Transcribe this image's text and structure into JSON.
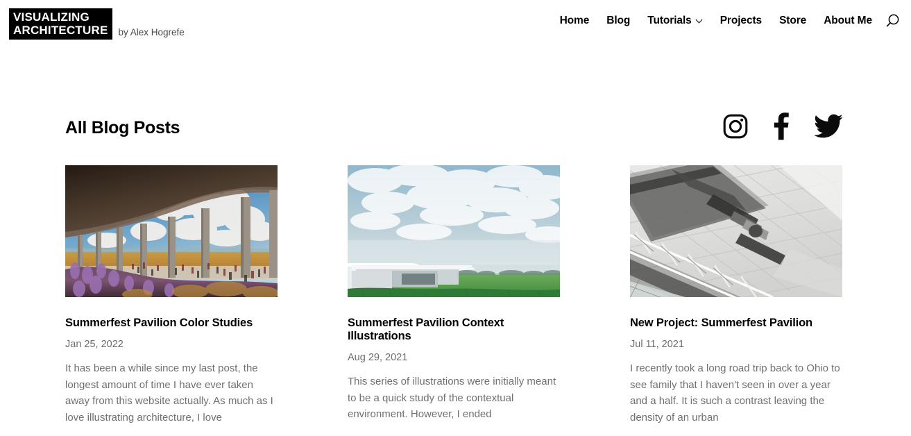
{
  "header": {
    "logo": {
      "line1": "VISUALIZING",
      "line2": "ARCHITECTURE",
      "byline": "by Alex Hogrefe"
    },
    "nav": [
      {
        "label": "Home",
        "has_dropdown": false
      },
      {
        "label": "Blog",
        "has_dropdown": false
      },
      {
        "label": "Tutorials",
        "has_dropdown": true
      },
      {
        "label": "Projects",
        "has_dropdown": false
      },
      {
        "label": "Store",
        "has_dropdown": false
      },
      {
        "label": "About Me",
        "has_dropdown": false
      }
    ],
    "search_icon": "search-icon"
  },
  "main": {
    "page_title": "All Blog Posts",
    "social": [
      {
        "name": "instagram-icon",
        "label": "Instagram"
      },
      {
        "name": "facebook-icon",
        "label": "Facebook"
      },
      {
        "name": "twitter-icon",
        "label": "Twitter"
      }
    ],
    "posts": [
      {
        "title": "Summerfest Pavilion Color Studies",
        "date": "Jan 25, 2022",
        "excerpt": "It has been a while since my last post, the longest amount of time I have ever taken away from this website actually. As much as I love illustrating architecture, I love",
        "image_alt": "Concrete pavilion canopy with columns overlooking golden field, lavender foreground, cumulus clouds"
      },
      {
        "title": "Summerfest Pavilion Context Illustrations",
        "date": "Aug 29, 2021",
        "excerpt": "This series of illustrations were initially meant to be a quick study of the contextual environment. However, I ended",
        "image_alt": "White pavilion roof at left with pale cloudy sky over green crop field and distant tree line"
      },
      {
        "title": "New Project: Summerfest Pavilion",
        "date": "Jul 11, 2021",
        "excerpt": "I recently took a long road trip back to Ohio to see family that I haven't seen in over a year and a half. It is such a contrast leaving the density of an urban",
        "image_alt": "Grayscale aerial view of gridded paving with linear canopy truss structure"
      }
    ]
  },
  "colors": {
    "text": "#000000",
    "muted": "#6e7073",
    "date": "#6b6b6b",
    "background": "#ffffff"
  }
}
